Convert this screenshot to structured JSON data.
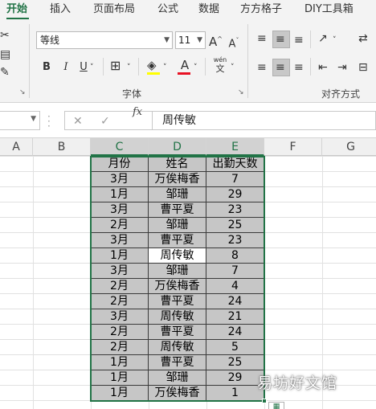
{
  "ribbon": {
    "tabs": [
      "开始",
      "插入",
      "页面布局",
      "公式",
      "数据",
      "方方格子",
      "DIY工具箱"
    ],
    "active_tab": "开始",
    "font_name": "等线",
    "font_size": "11",
    "font_group_label": "字体",
    "align_group_label": "对齐方式",
    "bold": "B",
    "italic": "I",
    "underline": "U",
    "grow_font": "A",
    "shrink_font": "A",
    "font_color": "A",
    "phonetic_top": "wén",
    "phonetic_bottom": "文",
    "accent_color": "#217346",
    "font_color_bar": "#e81123"
  },
  "formula_bar": {
    "fx": "fx",
    "content": "周传敏"
  },
  "columns": [
    "A",
    "B",
    "C",
    "D",
    "E",
    "F",
    "G"
  ],
  "table": {
    "headers": [
      "月份",
      "姓名",
      "出勤天数"
    ],
    "rows": [
      [
        "3月",
        "万俟梅香",
        "7"
      ],
      [
        "1月",
        "邹珊",
        "29"
      ],
      [
        "3月",
        "曹平夏",
        "23"
      ],
      [
        "2月",
        "邹珊",
        "25"
      ],
      [
        "3月",
        "曹平夏",
        "23"
      ],
      [
        "1月",
        "周传敏",
        "8"
      ],
      [
        "3月",
        "邹珊",
        "7"
      ],
      [
        "2月",
        "万俟梅香",
        "4"
      ],
      [
        "2月",
        "曹平夏",
        "24"
      ],
      [
        "3月",
        "周传敏",
        "21"
      ],
      [
        "2月",
        "曹平夏",
        "24"
      ],
      [
        "2月",
        "周传敏",
        "5"
      ],
      [
        "1月",
        "曹平夏",
        "25"
      ],
      [
        "1月",
        "邹珊",
        "29"
      ],
      [
        "1月",
        "万俟梅香",
        "1"
      ]
    ]
  },
  "watermark": "易坊好文馆"
}
